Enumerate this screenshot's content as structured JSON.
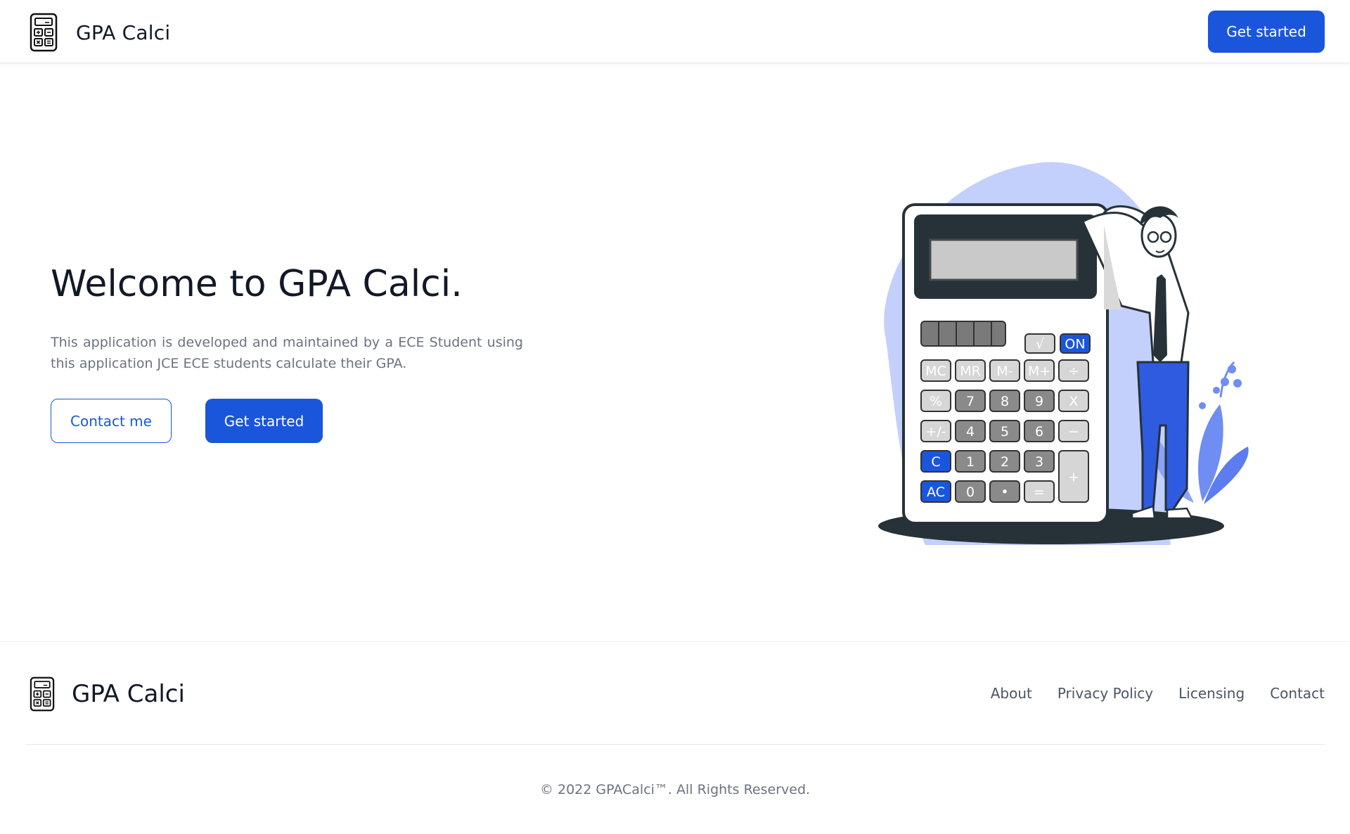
{
  "header": {
    "brand_name": "GPA Calci",
    "cta_label": "Get started"
  },
  "hero": {
    "title": "Welcome to GPA Calci.",
    "description": "This application is developed and maintained by a ECE Student using this application JCE ECE students calculate their GPA.",
    "contact_label": "Contact me",
    "cta_label": "Get started"
  },
  "illustration": {
    "calculator_keys": {
      "on": "ON",
      "sqrt": "√",
      "row1": [
        "MC",
        "MR",
        "M-",
        "M+",
        "÷"
      ],
      "row2": [
        "%",
        "7",
        "8",
        "9",
        "X"
      ],
      "row3": [
        "+/-",
        "4",
        "5",
        "6",
        "−"
      ],
      "row4": [
        "C",
        "1",
        "2",
        "3",
        "+"
      ],
      "row5": [
        "AC",
        "0",
        "•",
        "="
      ]
    }
  },
  "footer": {
    "brand_name": "GPA Calci",
    "links": [
      "About",
      "Privacy Policy",
      "Licensing",
      "Contact"
    ],
    "copyright": "© 2022 GPACalci™. All Rights Reserved."
  },
  "colors": {
    "primary": "#1a56db",
    "blob": "#c3d0fc",
    "calc_dark": "#263238",
    "key_grey": "#8a8a8a",
    "key_light": "#d6d6d6"
  },
  "icons": {
    "logo": "calculator-icon"
  }
}
